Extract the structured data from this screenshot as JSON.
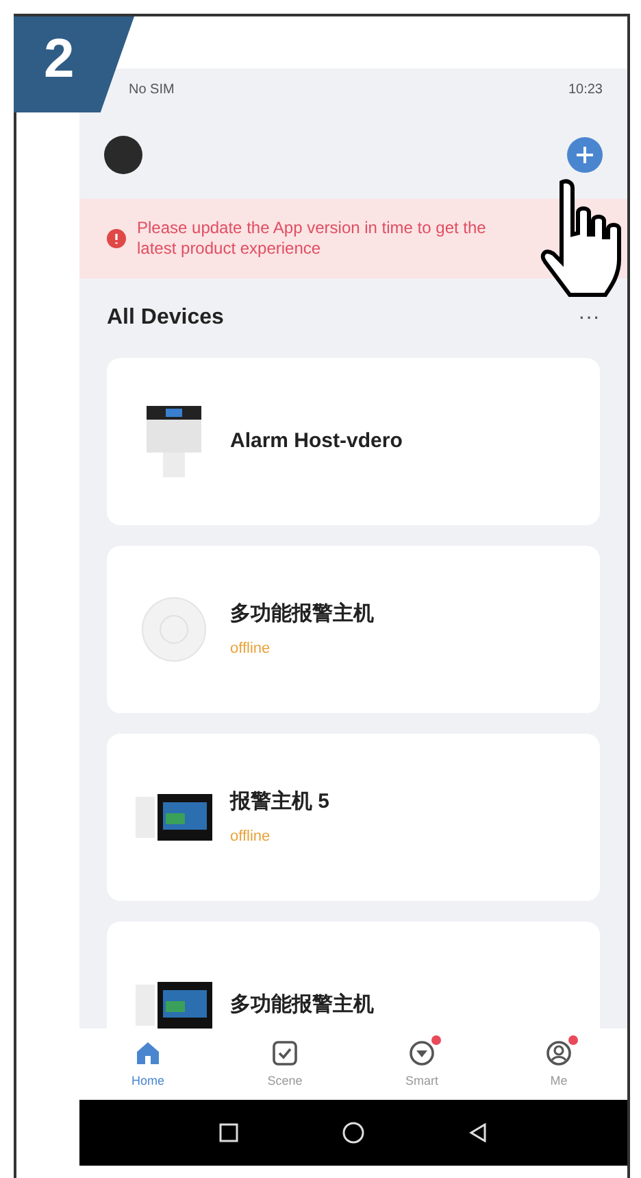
{
  "step": "2",
  "status_bar": {
    "left": "No SIM",
    "right": "10:23"
  },
  "banner": {
    "text": "Please update the App version in time to get the latest product experience"
  },
  "section": {
    "title": "All Devices",
    "more": "···"
  },
  "devices": [
    {
      "name": "Alarm Host-vdero",
      "kind": "panel"
    },
    {
      "name": "多功能报警主机",
      "status": "offline",
      "kind": "round"
    },
    {
      "name": "报警主机 5",
      "status": "offline",
      "kind": "screen"
    },
    {
      "name": "多功能报警主机",
      "kind": "screen"
    }
  ],
  "tabs": [
    {
      "label": "Home",
      "selected": true,
      "badge": false,
      "kind": "home"
    },
    {
      "label": "Scene",
      "selected": false,
      "badge": false,
      "kind": "scene"
    },
    {
      "label": "Smart",
      "selected": false,
      "badge": true,
      "kind": "smart"
    },
    {
      "label": "Me",
      "selected": false,
      "badge": true,
      "kind": "me"
    }
  ]
}
